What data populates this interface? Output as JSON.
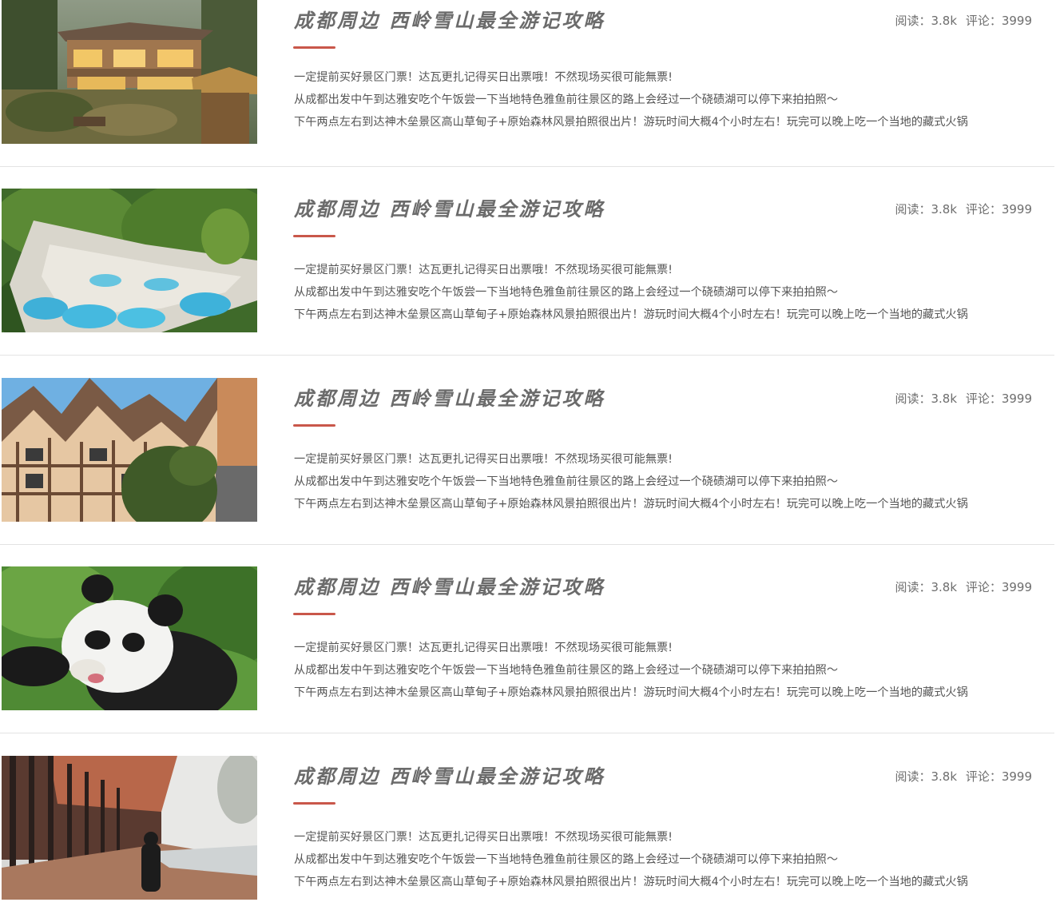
{
  "articles": [
    {
      "image": "villa-photo",
      "title": "成都周边 西岭雪山最全游记攻略",
      "reads": "阅读：3.8k",
      "comments": "评论：3999",
      "lines": [
        "一定提前买好景区门票！达瓦更扎记得买日出票哦！不然现场买很可能無票!",
        "从成都出发中午到达雅安吃个午饭尝一下当地特色雅鱼前往景区的路上会经过一个硗碛湖可以停下来拍拍照～",
        "下午两点左右到达神木垒景区高山草甸子+原始森林风景拍照很出片！游玩时间大概4个小时左右！玩完可以晚上吃一个当地的藏式火锅"
      ]
    },
    {
      "image": "pools-photo",
      "title": "成都周边 西岭雪山最全游记攻略",
      "reads": "阅读：3.8k",
      "comments": "评论：3999",
      "lines": [
        "一定提前买好景区门票！达瓦更扎记得买日出票哦！不然现场买很可能無票!",
        "从成都出发中午到达雅安吃个午饭尝一下当地特色雅鱼前往景区的路上会经过一个硗碛湖可以停下来拍拍照～",
        "下午两点左右到达神木垒景区高山草甸子+原始森林风景拍照很出片！游玩时间大概4个小时左右！玩完可以晚上吃一个当地的藏式火锅"
      ]
    },
    {
      "image": "timber-house-photo",
      "title": "成都周边 西岭雪山最全游记攻略",
      "reads": "阅读：3.8k",
      "comments": "评论：3999",
      "lines": [
        "一定提前买好景区门票！达瓦更扎记得买日出票哦！不然现场买很可能無票!",
        "从成都出发中午到达雅安吃个午饭尝一下当地特色雅鱼前往景区的路上会经过一个硗碛湖可以停下来拍拍照～",
        "下午两点左右到达神木垒景区高山草甸子+原始森林风景拍照很出片！游玩时间大概4个小时左右！玩完可以晚上吃一个当地的藏式火锅"
      ]
    },
    {
      "image": "panda-photo",
      "title": "成都周边 西岭雪山最全游记攻略",
      "reads": "阅读：3.8k",
      "comments": "评论：3999",
      "lines": [
        "一定提前买好景区门票！达瓦更扎记得买日出票哦！不然现场买很可能無票!",
        "从成都出发中午到达雅安吃个午饭尝一下当地特色雅鱼前往景区的路上会经过一个硗碛湖可以停下来拍拍照～",
        "下午两点左右到达神木垒景区高山草甸子+原始森林风景拍照很出片！游玩时间大概4个小时左右！玩完可以晚上吃一个当地的藏式火锅"
      ]
    },
    {
      "image": "forest-path-photo",
      "title": "成都周边 西岭雪山最全游记攻略",
      "reads": "阅读：3.8k",
      "comments": "评论：3999",
      "lines": [
        "一定提前买好景区门票！达瓦更扎记得买日出票哦！不然现场买很可能無票!",
        "从成都出发中午到达雅安吃个午饭尝一下当地特色雅鱼前往景区的路上会经过一个硗碛湖可以停下来拍拍照～",
        "下午两点左右到达神木垒景区高山草甸子+原始森林风景拍照很出片！游玩时间大概4个小时左右！玩完可以晚上吃一个当地的藏式火锅"
      ]
    }
  ],
  "colors": {
    "accent": "#c9574a",
    "title": "#6b6b6b",
    "text": "#555555",
    "divider": "#e3e3e3"
  }
}
